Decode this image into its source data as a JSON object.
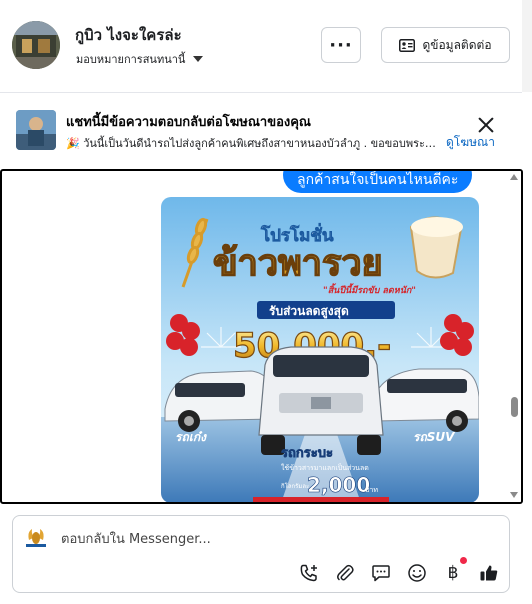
{
  "header": {
    "contact_name": "กูบิว ไงจะใครล่ะ",
    "assignment_label": "มอบหมายการสนทนานี้",
    "more_label": "···",
    "contact_info_label": "ดูข้อมูลติดต่อ"
  },
  "ad_notice": {
    "title": "แชทนี้มีข้อความตอบกลับต่อโฆษณาของคุณ",
    "subtitle": "🎉 วันนี้เป็นวันดีนำรถไปส่งลูกค้าคนพิเศษถึงสาขาหนองบัวลำภู . ขอขอบพระคุณ",
    "view_ad_link": "ดูโฆษณา"
  },
  "chat": {
    "outgoing_message": "ลูกค้าสนใจเป็นคนไหนดีคะ",
    "promo_image": {
      "headline": "โปรโมชั่น",
      "title": "ข้าวพารวย",
      "tagline": "\"สิ้นปีนี้มีรถขับ ลดหนัก\"",
      "discount_label": "รับส่วนลดสูงสุด",
      "discount_amount": "50,000.-",
      "label_left": "รถเก๋ง",
      "label_right": "รถSUV",
      "label_center": "รถกระบะ",
      "pickup_note": "ใช้ข้าวสารมาแลกเป็นส่วนลด",
      "pickup_unit": "กิโลกรัมละ",
      "pickup_amount": "2,000",
      "pickup_currency": "บาท"
    }
  },
  "composer": {
    "placeholder": "ตอบกลับใน Messenger...",
    "tools": [
      "phone-add-icon",
      "attachment-icon",
      "quick-reply-icon",
      "emoji-icon",
      "payment-icon",
      "like-icon"
    ],
    "payment_symbol": "฿"
  },
  "colors": {
    "accent": "#0a7cff",
    "link": "#0a66c2",
    "notification_dot": "#f02849"
  }
}
